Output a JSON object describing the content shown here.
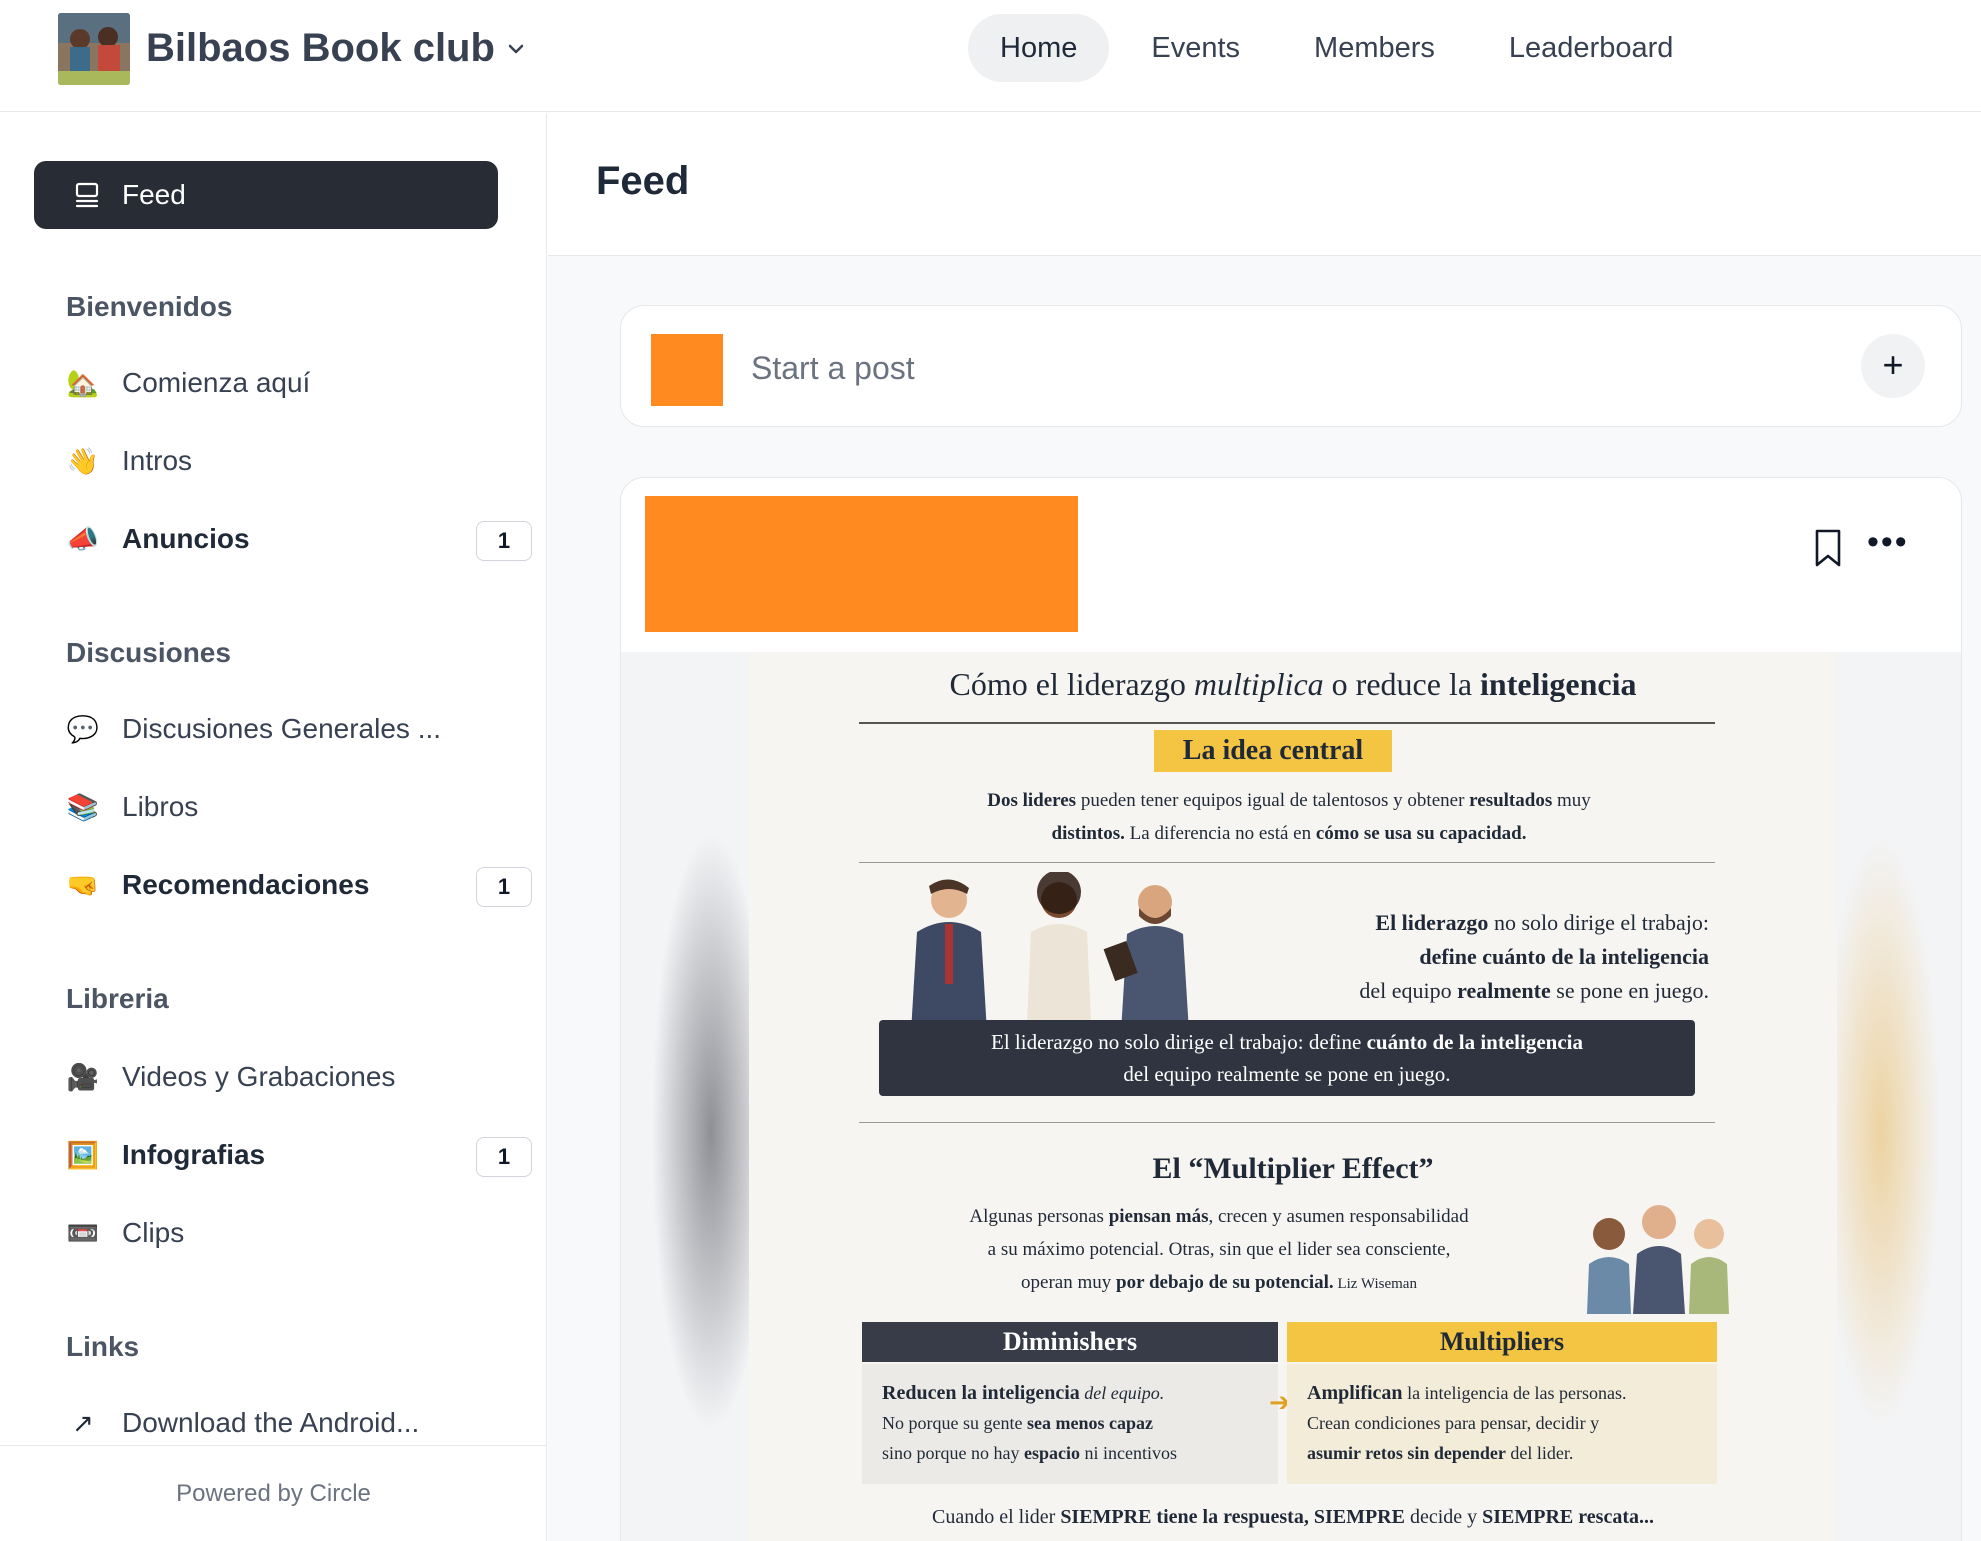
{
  "header": {
    "club_name": "Bilbaos Book club",
    "nav": [
      {
        "label": "Home",
        "active": true
      },
      {
        "label": "Events",
        "active": false
      },
      {
        "label": "Members",
        "active": false
      },
      {
        "label": "Leaderboard",
        "active": false
      }
    ]
  },
  "sidebar": {
    "feed_label": "Feed",
    "sections": [
      {
        "title": "Bienvenidos",
        "items": [
          {
            "emoji": "🏡",
            "label": "Comienza aquí",
            "bold": false,
            "badge": null
          },
          {
            "emoji": "👋",
            "label": "Intros",
            "bold": false,
            "badge": null
          },
          {
            "emoji": "📣",
            "label": "Anuncios",
            "bold": true,
            "badge": "1"
          }
        ]
      },
      {
        "title": "Discusiones",
        "items": [
          {
            "emoji": "💬",
            "label": "Discusiones Generales ...",
            "bold": false,
            "badge": null
          },
          {
            "emoji": "📚",
            "label": "Libros",
            "bold": false,
            "badge": null
          },
          {
            "emoji": "🤜",
            "label": "Recomendaciones",
            "bold": true,
            "badge": "1"
          }
        ]
      },
      {
        "title": "Libreria",
        "items": [
          {
            "emoji": "🎥",
            "label": "Videos y Grabaciones",
            "bold": false,
            "badge": null
          },
          {
            "emoji": "🖼️",
            "label": "Infografias",
            "bold": true,
            "badge": "1"
          },
          {
            "emoji": "📼",
            "label": "Clips",
            "bold": false,
            "badge": null
          }
        ]
      },
      {
        "title": "Links",
        "items": [
          {
            "emoji": "↗",
            "label": "Download the Android...",
            "bold": false,
            "badge": null
          }
        ]
      }
    ],
    "powered_by": "Powered by Circle"
  },
  "main": {
    "title": "Feed",
    "composer_placeholder": "Start a post",
    "composer_plus": "+",
    "post_more": "•••"
  },
  "infographic": {
    "title_pre": "Cómo el liderazgo ",
    "title_em": "multiplica",
    "title_mid": " o reduce la ",
    "title_bold": "inteligencia",
    "pill": "La idea central",
    "central_1a": "Dos lideres",
    "central_1b": " pueden tener equipos igual de talentosos y obtener ",
    "central_1c": "resultados",
    "central_1d": " muy",
    "central_2a": "distintos.",
    "central_2b": " La diferencia no está en ",
    "central_2c": "cómo se usa su capacidad.",
    "lead_1a": "El liderazgo",
    "lead_1b": " no solo dirige el trabajo:",
    "lead_2": "define cuánto de la inteligencia",
    "lead_3a": "del equipo ",
    "lead_3b": "realmente",
    "lead_3c": " se pone en juego.",
    "banner_1a": "El liderazgo no solo dirige el trabajo: define ",
    "banner_1b": "cuánto de la inteligencia",
    "banner_2": "del equipo realmente se pone en juego.",
    "me_title": "El “Multiplier Effect”",
    "me_1a": "Algunas personas ",
    "me_1b": "piensan más",
    "me_1c": ", crecen y asumen responsabilidad",
    "me_2": "a su máximo potencial. Otras, sin que el lider sea consciente,",
    "me_3a": "operan muy ",
    "me_3b": "por debajo de su potencial.",
    "me_3c": " Liz Wiseman",
    "dim_head": "Diminishers",
    "mul_head": "Multipliers",
    "dim_1a": "Reducen la inteligencia",
    "dim_1b": " del equipo.",
    "dim_2a": "No porque su gente ",
    "dim_2b": "sea menos capaz",
    "dim_3a": "sino porque no hay ",
    "dim_3b": "espacio",
    "dim_3c": " ni incentivos",
    "mul_1a": "Amplifican",
    "mul_1b": " la inteligencia de las personas.",
    "mul_2": "Crean condiciones para pensar, decidir y",
    "mul_3a": "asumir retos sin depender",
    "mul_3b": " del lider.",
    "footer_a": "Cuando el lider ",
    "footer_b": "SIEMPRE tiene la respuesta, SIEMPRE",
    "footer_c": " decide y ",
    "footer_d": "SIEMPRE rescata..."
  }
}
